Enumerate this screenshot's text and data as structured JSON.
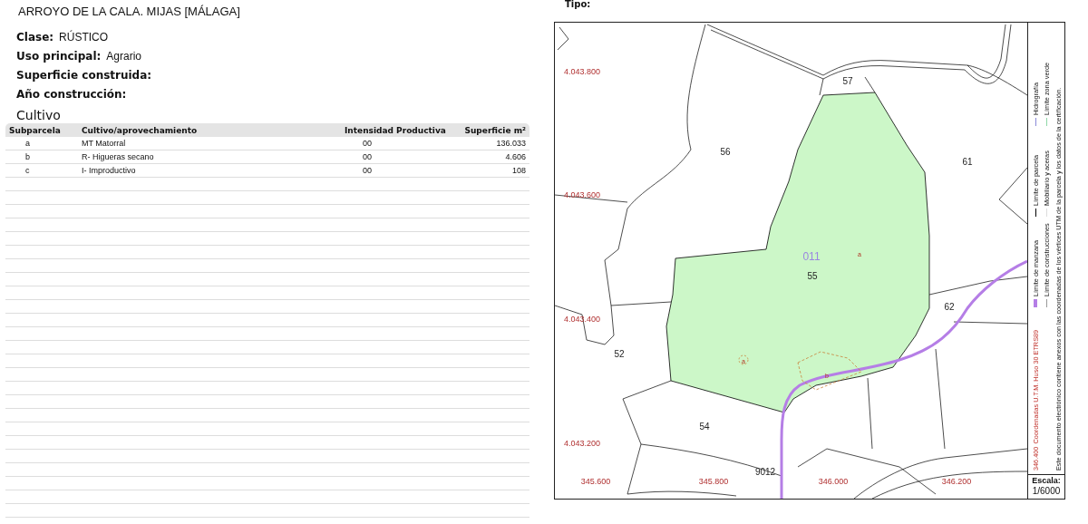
{
  "header": {
    "address": "ARROYO DE LA CALA. MIJAS [MÁLAGA]"
  },
  "fields": [
    {
      "label": "Clase:",
      "value": "RÚSTICO"
    },
    {
      "label": "Uso principal:",
      "value": "Agrario"
    },
    {
      "label": "Superficie construida:"
    },
    {
      "label": "Año construcción:"
    }
  ],
  "cultivo": {
    "title": "Cultivo",
    "columns": [
      "Subparcela",
      "Cultivo/aprovechamiento",
      "Intensidad Productiva",
      "Superficie m²"
    ],
    "rows": [
      [
        "a",
        "MT Matorral",
        "00",
        "136.033"
      ],
      [
        "b",
        "R- Higueras secano",
        "00",
        "4.606"
      ],
      [
        "c",
        "I- Improductivo",
        "00",
        "108"
      ]
    ]
  },
  "map": {
    "label": "Tipo:",
    "labels": [
      {
        "text": "57",
        "kind": "parcel"
      },
      {
        "text": "56",
        "kind": "parcel"
      },
      {
        "text": "61",
        "kind": "parcel"
      },
      {
        "text": "011",
        "kind": "block"
      },
      {
        "text": "a",
        "kind": "subparcel"
      },
      {
        "text": "55",
        "kind": "parcel"
      },
      {
        "text": "62",
        "kind": "parcel"
      },
      {
        "text": "52",
        "kind": "parcel"
      },
      {
        "text": "a",
        "kind": "subparcel"
      },
      {
        "text": "b",
        "kind": "subparcel"
      },
      {
        "text": "54",
        "kind": "parcel"
      },
      {
        "text": "9012",
        "kind": "parcel"
      }
    ],
    "y_coords": [
      "4.043.800",
      "4.043.600",
      "4.043.400",
      "4.043.200"
    ],
    "x_coords": [
      "345.600",
      "345.800",
      "346.000",
      "346.200"
    ],
    "legend": {
      "crs_tick": "346.400",
      "crs": "Coordenadas U.T.M. Huso 30 ETRS89",
      "items": [
        {
          "label": "Límite de manzana",
          "color": "#b57ee6",
          "kind": "bar"
        },
        {
          "label": "Límite de parcela",
          "color": "#000000",
          "kind": "line"
        },
        {
          "label": "Hidrografía",
          "color": "#8a8ad8",
          "kind": "line"
        },
        {
          "label": "Límite de construcciones",
          "color": "#999999",
          "kind": "line"
        },
        {
          "label": "Mobiliario y aceras",
          "color": "#dddddd",
          "kind": "line"
        },
        {
          "label": "Límite zona verde",
          "color": "#8fd8a8",
          "kind": "line"
        }
      ],
      "note": "Este documento electrónico contiene anexos con las coordenadas de los vértices UTM de la parcela y los datos de la certificación."
    },
    "scale": {
      "label": "Escala:",
      "value": "1/6000"
    }
  }
}
